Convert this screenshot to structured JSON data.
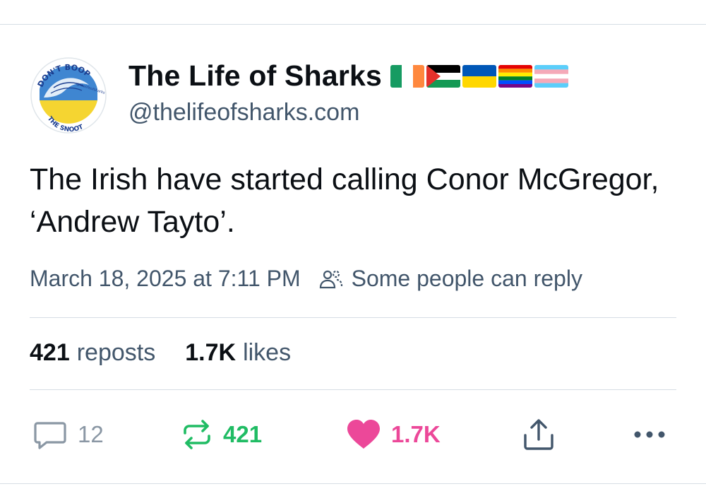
{
  "author": {
    "display_name": "The Life of Sharks",
    "handle": "@thelifeofsharks.com",
    "avatar": {
      "icon": "shark-sticker-avatar",
      "text_top": "DON'T BOOP",
      "text_bottom": "THE SNOOT",
      "text_small": "@thelifeofsharks",
      "colors": {
        "blue": "#1f6fbf",
        "yellow": "#f5d531",
        "text": "#1b3d8f"
      }
    },
    "flags": [
      "ireland-flag",
      "palestine-flag",
      "ukraine-flag",
      "rainbow-flag",
      "transgender-flag"
    ]
  },
  "post": {
    "text": "The Irish have started calling Conor McGregor, ‘Andrew Tayto’.",
    "timestamp": "March 18, 2025 at 7:11 PM",
    "reply_setting": "Some people can reply"
  },
  "stats": {
    "reposts_count": "421",
    "reposts_label": "reposts",
    "likes_count": "1.7K",
    "likes_label": "likes"
  },
  "actions": {
    "reply_count": "12",
    "repost_count": "421",
    "like_count": "1.7K"
  },
  "colors": {
    "repost_active": "#20bc64",
    "like_active": "#ec4899",
    "muted": "#42566b",
    "divider": "#d6dde4"
  }
}
